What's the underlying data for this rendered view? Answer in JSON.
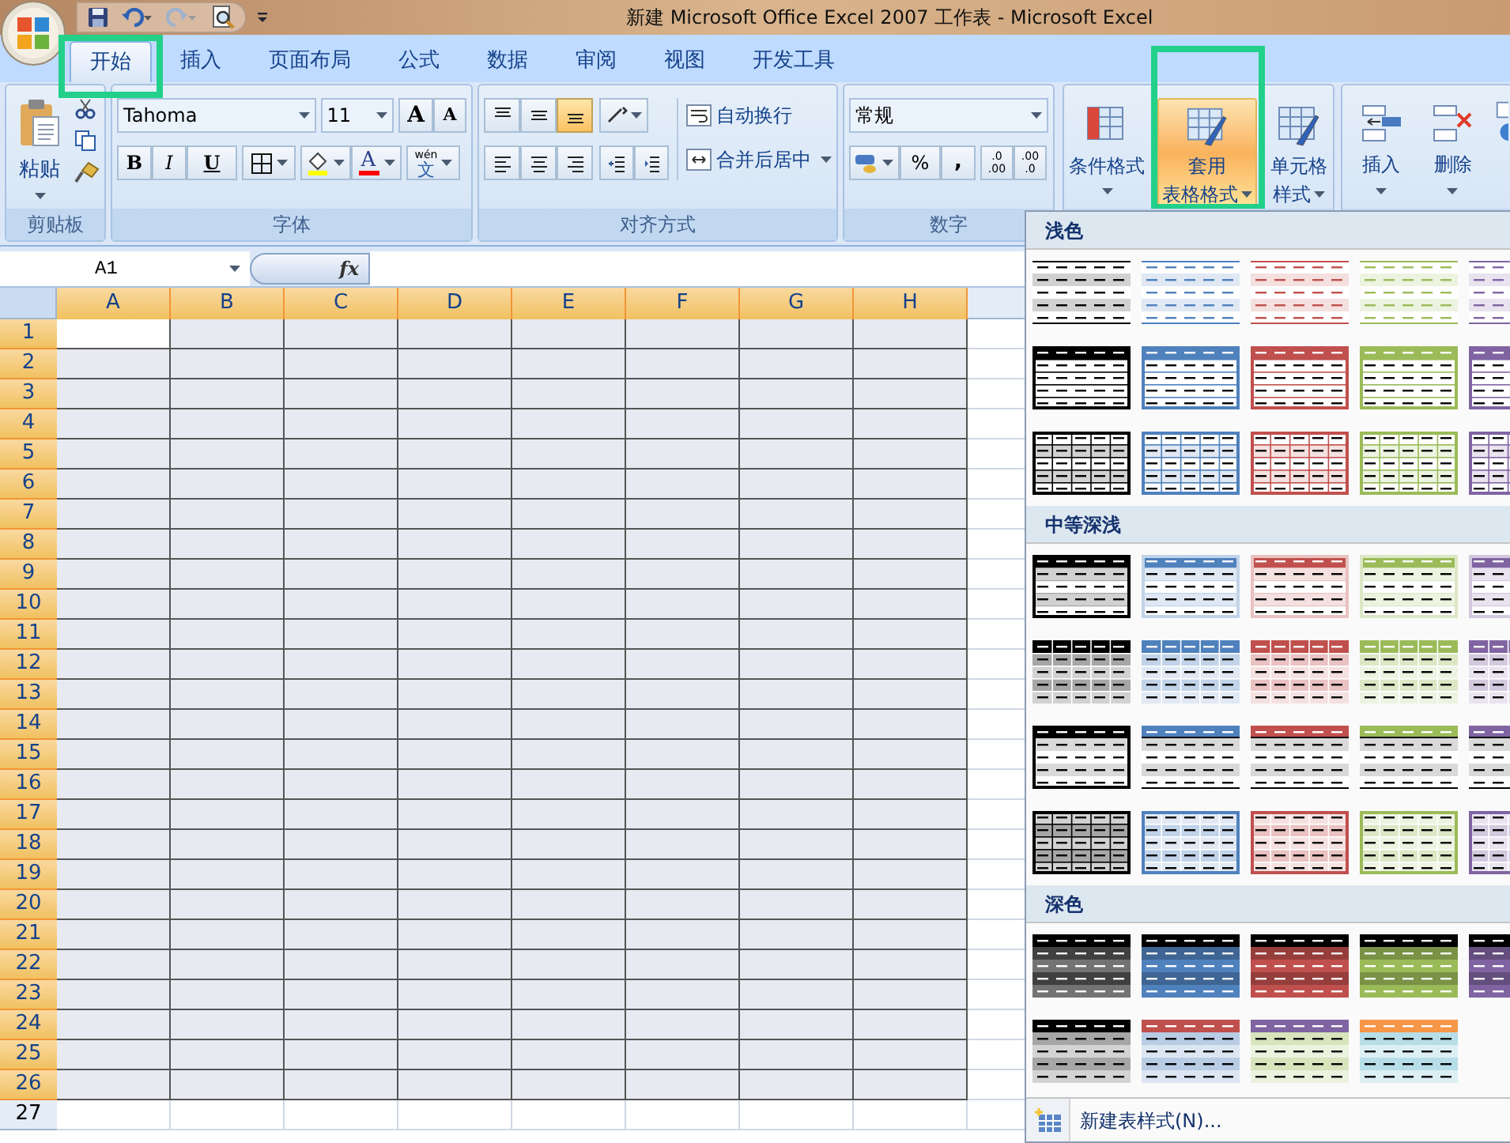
{
  "window": {
    "title": "新建 Microsoft Office Excel 2007 工作表 - Microsoft Excel"
  },
  "tabs": [
    {
      "label": "开始",
      "selected": true
    },
    {
      "label": "插入",
      "selected": false
    },
    {
      "label": "页面布局",
      "selected": false
    },
    {
      "label": "公式",
      "selected": false
    },
    {
      "label": "数据",
      "selected": false
    },
    {
      "label": "审阅",
      "selected": false
    },
    {
      "label": "视图",
      "selected": false
    },
    {
      "label": "开发工具",
      "selected": false
    }
  ],
  "ribbon": {
    "clipboard": {
      "label": "剪贴板",
      "paste": "粘贴"
    },
    "font": {
      "label": "字体",
      "font_name": "Tahoma",
      "font_size": "11",
      "grow": "A",
      "shrink": "A",
      "bold": "B",
      "italic": "I",
      "underline": "U",
      "font_color": "A",
      "phonetic_top": "wén",
      "phonetic_bottom": "文"
    },
    "alignment": {
      "label": "对齐方式",
      "vertical_align": [
        {
          "selected": false
        },
        {
          "selected": false
        },
        {
          "selected": true
        }
      ],
      "wrap_text": "自动换行",
      "merge_center": "合并后居中"
    },
    "number": {
      "label": "数字",
      "format": "常规",
      "percent": "%",
      "comma": ",",
      "increase_decimal": [
        ".0",
        ".00"
      ],
      "decrease_decimal": [
        ".00",
        ".0"
      ]
    },
    "styles": {
      "buttons": [
        {
          "lines": [
            "条件格式"
          ],
          "selected": false
        },
        {
          "lines": [
            "套用",
            "表格格式"
          ],
          "selected": true
        },
        {
          "lines": [
            "单元格",
            "样式"
          ],
          "selected": false
        }
      ]
    },
    "cells": {
      "buttons": [
        {
          "label": "插入"
        },
        {
          "label": "删除"
        }
      ]
    }
  },
  "formula_bar": {
    "name_box": "A1",
    "fx": "fx"
  },
  "sheet": {
    "columns": [
      {
        "label": "A",
        "selected": true
      },
      {
        "label": "B",
        "selected": true
      },
      {
        "label": "C",
        "selected": true
      },
      {
        "label": "D",
        "selected": true
      },
      {
        "label": "E",
        "selected": true
      },
      {
        "label": "F",
        "selected": true
      },
      {
        "label": "G",
        "selected": true
      },
      {
        "label": "H",
        "selected": true
      }
    ],
    "rows": [
      {
        "label": "1",
        "selected": true
      },
      {
        "label": "2",
        "selected": true
      },
      {
        "label": "3",
        "selected": true
      },
      {
        "label": "4",
        "selected": true
      },
      {
        "label": "5",
        "selected": true
      },
      {
        "label": "6",
        "selected": true
      },
      {
        "label": "7",
        "selected": true
      },
      {
        "label": "8",
        "selected": true
      },
      {
        "label": "9",
        "selected": true
      },
      {
        "label": "10",
        "selected": true
      },
      {
        "label": "11",
        "selected": true
      },
      {
        "label": "12",
        "selected": true
      },
      {
        "label": "13",
        "selected": true
      },
      {
        "label": "14",
        "selected": true
      },
      {
        "label": "15",
        "selected": true
      },
      {
        "label": "16",
        "selected": true
      },
      {
        "label": "17",
        "selected": true
      },
      {
        "label": "18",
        "selected": true
      },
      {
        "label": "19",
        "selected": true
      },
      {
        "label": "20",
        "selected": true
      },
      {
        "label": "21",
        "selected": true
      },
      {
        "label": "22",
        "selected": true
      },
      {
        "label": "23",
        "selected": true
      },
      {
        "label": "24",
        "selected": true
      },
      {
        "label": "25",
        "selected": true
      },
      {
        "label": "26",
        "selected": true
      },
      {
        "label": "27",
        "selected": false
      }
    ]
  },
  "gallery": {
    "sections": [
      {
        "title": "浅色",
        "rows": [
          [
            {
              "kind": "light-banded",
              "color": "#000000"
            },
            {
              "kind": "light-banded",
              "color": "#4f81bd"
            },
            {
              "kind": "light-banded",
              "color": "#c0504d"
            },
            {
              "kind": "light-banded",
              "color": "#9bbb59"
            },
            {
              "kind": "light-banded",
              "color": "#8064a2"
            }
          ],
          [
            {
              "kind": "light-header",
              "color": "#000000"
            },
            {
              "kind": "light-header",
              "color": "#4f81bd"
            },
            {
              "kind": "light-header",
              "color": "#c0504d"
            },
            {
              "kind": "light-header",
              "color": "#9bbb59"
            },
            {
              "kind": "light-header",
              "color": "#8064a2"
            }
          ],
          [
            {
              "kind": "light-grid",
              "color": "#000000"
            },
            {
              "kind": "light-grid",
              "color": "#4f81bd"
            },
            {
              "kind": "light-grid",
              "color": "#c0504d"
            },
            {
              "kind": "light-grid",
              "color": "#9bbb59"
            },
            {
              "kind": "light-grid",
              "color": "#8064a2"
            }
          ]
        ]
      },
      {
        "title": "中等深浅",
        "rows": [
          [
            {
              "kind": "medium-banded",
              "color": "#000000"
            },
            {
              "kind": "medium-banded",
              "color": "#4f81bd"
            },
            {
              "kind": "medium-banded",
              "color": "#c0504d"
            },
            {
              "kind": "medium-banded",
              "color": "#9bbb59"
            },
            {
              "kind": "medium-banded",
              "color": "#8064a2"
            }
          ],
          [
            {
              "kind": "medium-cells",
              "color": "#000000"
            },
            {
              "kind": "medium-cells",
              "color": "#4f81bd"
            },
            {
              "kind": "medium-cells",
              "color": "#c0504d"
            },
            {
              "kind": "medium-cells",
              "color": "#9bbb59"
            },
            {
              "kind": "medium-cells",
              "color": "#8064a2"
            }
          ],
          [
            {
              "kind": "medium-topline",
              "color": "#000000"
            },
            {
              "kind": "medium-topline",
              "color": "#4f81bd"
            },
            {
              "kind": "medium-topline",
              "color": "#c0504d"
            },
            {
              "kind": "medium-topline",
              "color": "#9bbb59"
            },
            {
              "kind": "medium-topline",
              "color": "#8064a2"
            }
          ],
          [
            {
              "kind": "medium-grid",
              "color": "#000000"
            },
            {
              "kind": "medium-grid",
              "color": "#4f81bd"
            },
            {
              "kind": "medium-grid",
              "color": "#c0504d"
            },
            {
              "kind": "medium-grid",
              "color": "#9bbb59"
            },
            {
              "kind": "medium-grid",
              "color": "#8064a2"
            }
          ]
        ]
      },
      {
        "title": "深色",
        "rows": [
          [
            {
              "kind": "dark-banded",
              "color": "#000000"
            },
            {
              "kind": "dark-banded",
              "color": "#4f81bd"
            },
            {
              "kind": "dark-banded",
              "color": "#c0504d"
            },
            {
              "kind": "dark-banded",
              "color": "#9bbb59"
            },
            {
              "kind": "dark-banded",
              "color": "#8064a2"
            }
          ],
          [
            {
              "kind": "dark-accent",
              "color": "#000000",
              "bands": {
                "color": "#a6a6a6"
              }
            },
            {
              "kind": "dark-accent",
              "color": "#c0504d",
              "bands": {
                "color": "#b8cce4"
              }
            },
            {
              "kind": "dark-accent",
              "color": "#8064a2",
              "bands": {
                "color": "#d7e4bc"
              }
            },
            {
              "kind": "dark-accent",
              "color": "#f79646",
              "bands": {
                "color": "#b7dee8"
              }
            }
          ]
        ]
      }
    ],
    "new_style": "新建表样式(N)..."
  }
}
